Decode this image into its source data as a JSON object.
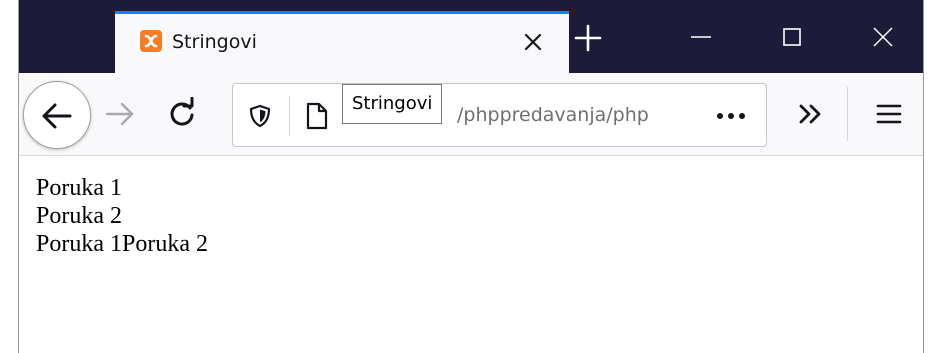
{
  "tab": {
    "title": "Stringovi",
    "favicon": "xampp-icon",
    "favicon_color": "#fb7a24"
  },
  "toolbar": {
    "url_visible": "/phppredavanja/php",
    "tooltip": "Stringovi"
  },
  "colors": {
    "titlebar": "#1c1b39",
    "tab_accent": "#0a84ff",
    "toolbar": "#f9f9fb"
  },
  "page": {
    "lines": [
      "Poruka 1",
      "Poruka 2",
      "Poruka 1Poruka 2"
    ]
  }
}
